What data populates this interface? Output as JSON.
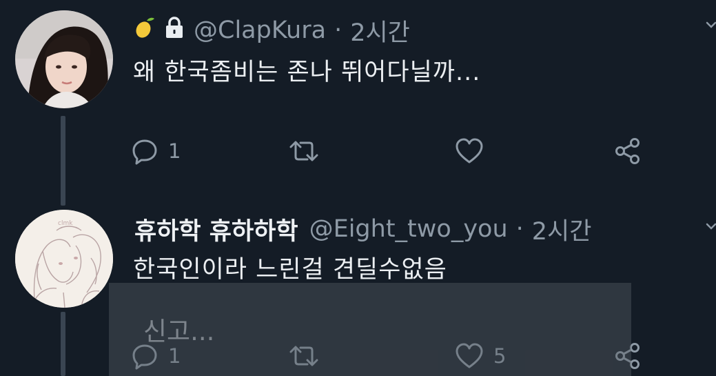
{
  "tweets": [
    {
      "display_name": "",
      "badges": [
        "lemon-icon",
        "lock-icon"
      ],
      "handle": "@ClapKura",
      "time": "2시간",
      "text": "왜 한국좀비는 존나 뛰어다닐까...",
      "reply_count": "1",
      "like_count": ""
    },
    {
      "display_name": "휴하학 휴하하학",
      "handle": "@Eight_two_you",
      "time": "2시간",
      "text": "한국인이라 느린걸 견딜수없음",
      "reply_count": "1",
      "like_count": "5"
    }
  ],
  "overlay": {
    "label": "신고..."
  },
  "colors": {
    "background": "#141c26",
    "muted": "#8e9aa6",
    "text": "#eceff2",
    "thread_line": "#3a4552"
  }
}
